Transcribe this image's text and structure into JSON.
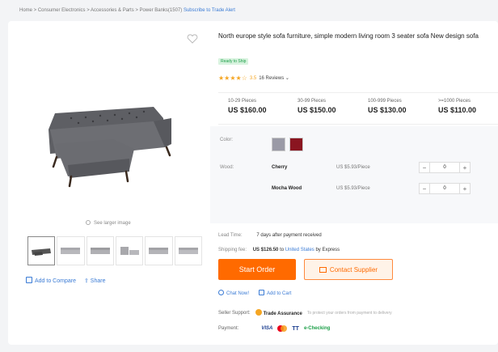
{
  "breadcrumb": {
    "path": "Home > Consumer Electronics > Accessories & Parts > Power Banks(1507)",
    "subscribe": "Subscribe to Trade Alert"
  },
  "gallery": {
    "view_larger": "See larger image",
    "compare_label": "Add to Compare",
    "share_label": "Share",
    "thumbnail_count": 6,
    "active_thumbnail": 1
  },
  "product": {
    "title": "North europe style sofa furniture, simple modern living room 3 seater sofa New design sofa",
    "ready_badge": "Ready to Ship",
    "rating": 3.5,
    "rating_text": "3.5",
    "reviews_text": "16 Reviews",
    "price_tiers": [
      {
        "range": "10-29 Pieces",
        "price": "US $160.00"
      },
      {
        "range": "30-99 Pieces",
        "price": "US $150.00"
      },
      {
        "range": "100-999 Pieces",
        "price": "US $130.00"
      },
      {
        "range": ">=1000 Pieces",
        "price": "US $110.00"
      }
    ]
  },
  "options": {
    "color_label": "Color:",
    "colors": [
      "#9a9aa6",
      "#8a1520"
    ],
    "wood_label": "Wood:",
    "variants": [
      {
        "name": "Cherry",
        "price": "US $5.93/Piece",
        "qty": "0"
      },
      {
        "name": "Mocha Wood",
        "price": "US $5.93/Piece",
        "qty": "0"
      }
    ],
    "stepper_minus": "−",
    "stepper_plus": "+"
  },
  "shipping": {
    "lead_label": "Lead Time:",
    "lead_value": "7 days after payment received",
    "fee_label": "Shipping fee:",
    "fee_value": "US $126.50",
    "fee_to": "to",
    "destination": "United States",
    "fee_method": "by Express"
  },
  "actions": {
    "start_order": "Start Order",
    "contact": "Contact Supplier",
    "chat": "Chat Now!",
    "cart": "Add to Cart"
  },
  "support": {
    "label": "Seller Support:",
    "trade_assurance": "Trade Assurance",
    "trade_note": "To protect your orders from payment to delivery"
  },
  "payment": {
    "label": "Payment:",
    "methods": [
      "VISA",
      "TT",
      "e-Checking"
    ]
  },
  "colors": {
    "accent": "#ff6a00",
    "link": "#3a7bd5",
    "star": "#f5a623",
    "ready_green": "#1a9e46"
  }
}
